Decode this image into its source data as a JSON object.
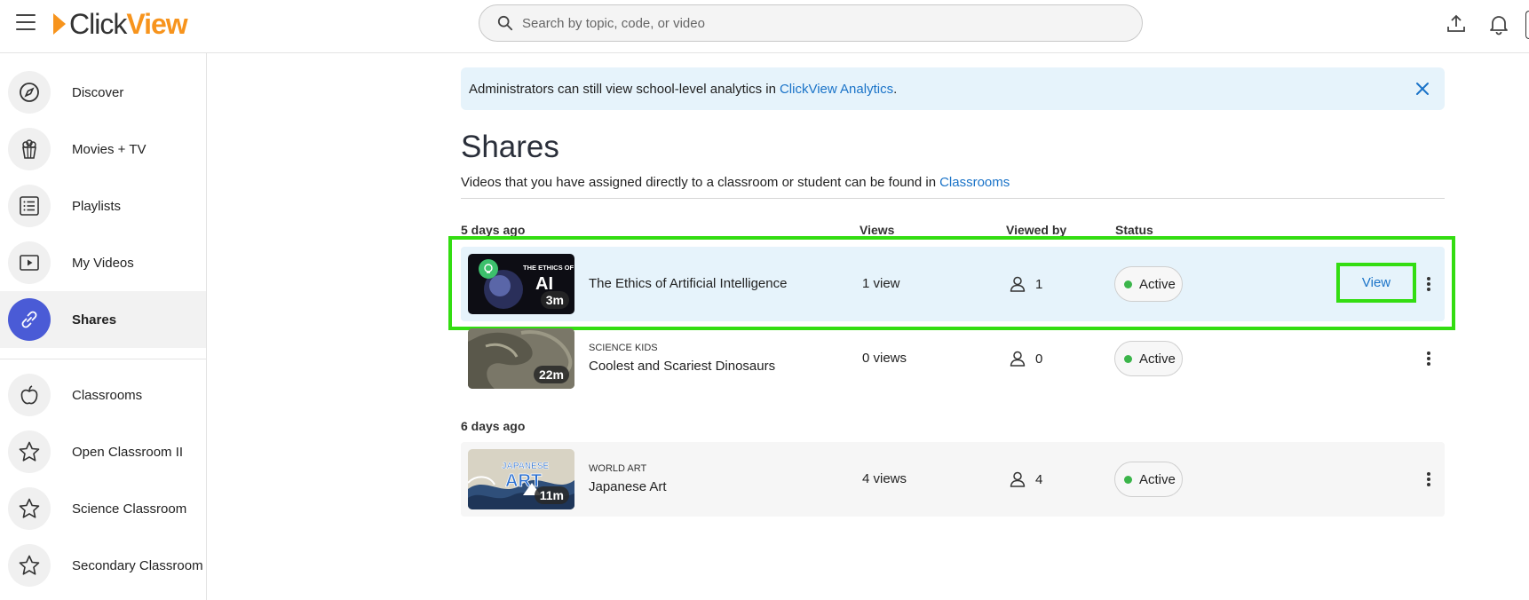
{
  "header": {
    "logo_click": "Click",
    "logo_view": "View",
    "search_placeholder": "Search by topic, code, or video"
  },
  "sidebar": {
    "items": [
      {
        "label": "Discover",
        "icon": "compass-icon"
      },
      {
        "label": "Movies + TV",
        "icon": "popcorn-icon"
      },
      {
        "label": "Playlists",
        "icon": "list-icon"
      },
      {
        "label": "My Videos",
        "icon": "play-icon"
      },
      {
        "label": "Shares",
        "icon": "link-icon",
        "active": true
      },
      {
        "label": "Classrooms",
        "icon": "apple-icon"
      },
      {
        "label": "Open Classroom II",
        "icon": "star-icon"
      },
      {
        "label": "Science Classroom",
        "icon": "star-icon"
      },
      {
        "label": "Secondary Classroom",
        "icon": "star-icon"
      }
    ]
  },
  "banner": {
    "text": "Administrators can still view school-level analytics in",
    "link": "ClickView Analytics",
    "suffix": "."
  },
  "page": {
    "title": "Shares",
    "subtitle": "Videos that you have assigned directly to a classroom or student can be found in",
    "subtitle_link": "Classrooms"
  },
  "columns": {
    "views": "Views",
    "viewed_by": "Viewed by",
    "status": "Status"
  },
  "groups": [
    {
      "label": "5 days ago",
      "rows": [
        {
          "category": "",
          "title": "The Ethics of Artificial Intelligence",
          "duration": "3m",
          "views": "1 view",
          "viewed_by": "1",
          "status": "Active",
          "action": "View"
        },
        {
          "category": "SCIENCE KIDS",
          "title": "Coolest and Scariest Dinosaurs",
          "duration": "22m",
          "views": "0 views",
          "viewed_by": "0",
          "status": "Active"
        }
      ]
    },
    {
      "label": "6 days ago",
      "rows": [
        {
          "category": "WORLD ART",
          "title": "Japanese Art",
          "duration": "11m",
          "views": "4 views",
          "viewed_by": "4",
          "status": "Active"
        }
      ]
    }
  ],
  "thumb_text": {
    "ethics": "THE ETHICS OF",
    "ethics_big": "AI",
    "japanese": "JAPANESE",
    "japanese_big": "ART"
  },
  "colors": {
    "brand_orange": "#f7941d",
    "accent_blue": "#4a5bd6",
    "link_blue": "#1a73c8",
    "status_green": "#3bb54a",
    "highlight_green": "#33dd11"
  }
}
